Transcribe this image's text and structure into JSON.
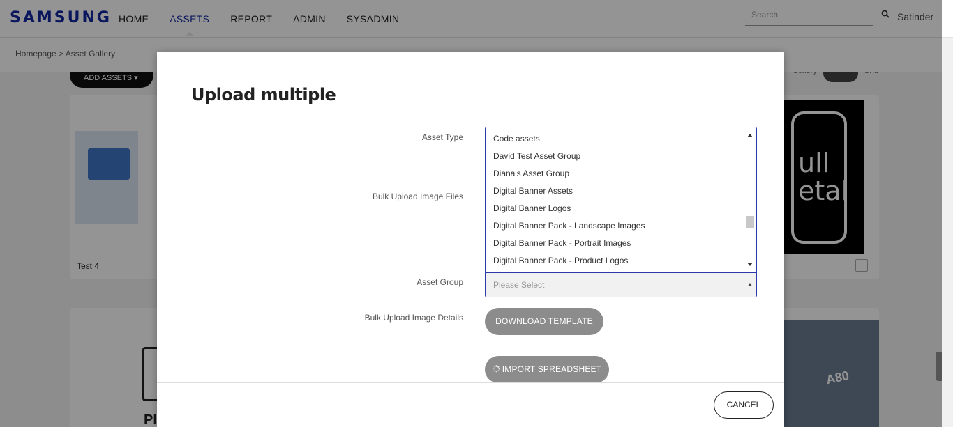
{
  "header": {
    "logo": "SAMSUNG",
    "nav": [
      {
        "label": "HOME",
        "active": false
      },
      {
        "label": "ASSETS",
        "active": true
      },
      {
        "label": "REPORT",
        "active": false
      },
      {
        "label": "ADMIN",
        "active": false
      },
      {
        "label": "SYSADMIN",
        "active": false
      }
    ],
    "search_placeholder": "Search",
    "username": "Satinder"
  },
  "breadcrumb": {
    "text": "Homepage > Asset Gallery"
  },
  "background": {
    "add_assets_label": "ADD ASSETS ▾",
    "view_toggle_left": "Gallery",
    "view_toggle_right": "Grid",
    "card_title": "Test 4",
    "right_thumb_text": "ull\netal",
    "photo_text": "A80",
    "card2_partial_text": "PI"
  },
  "modal": {
    "title": "Upload multiple",
    "labels": {
      "asset_type": "Asset Type",
      "bulk_upload_files": "Bulk Upload Image Files",
      "asset_group": "Asset Group",
      "bulk_upload_details": "Bulk Upload Image Details"
    },
    "asset_type_options": [
      "Code assets",
      "David Test Asset Group",
      "Diana's Asset Group",
      "Digital Banner Assets",
      "Digital Banner Logos",
      "Digital Banner Pack - Landscape Images",
      "Digital Banner Pack - Portrait Images",
      "Digital Banner Pack - Product Logos"
    ],
    "asset_group_placeholder": "Please Select",
    "download_template_label": "DOWNLOAD TEMPLATE",
    "import_spreadsheet_label": "IMPORT SPREADSHEET",
    "cancel_label": "CANCEL"
  },
  "colors": {
    "brand": "#1428a0",
    "button_grey": "#8c8c8c"
  }
}
